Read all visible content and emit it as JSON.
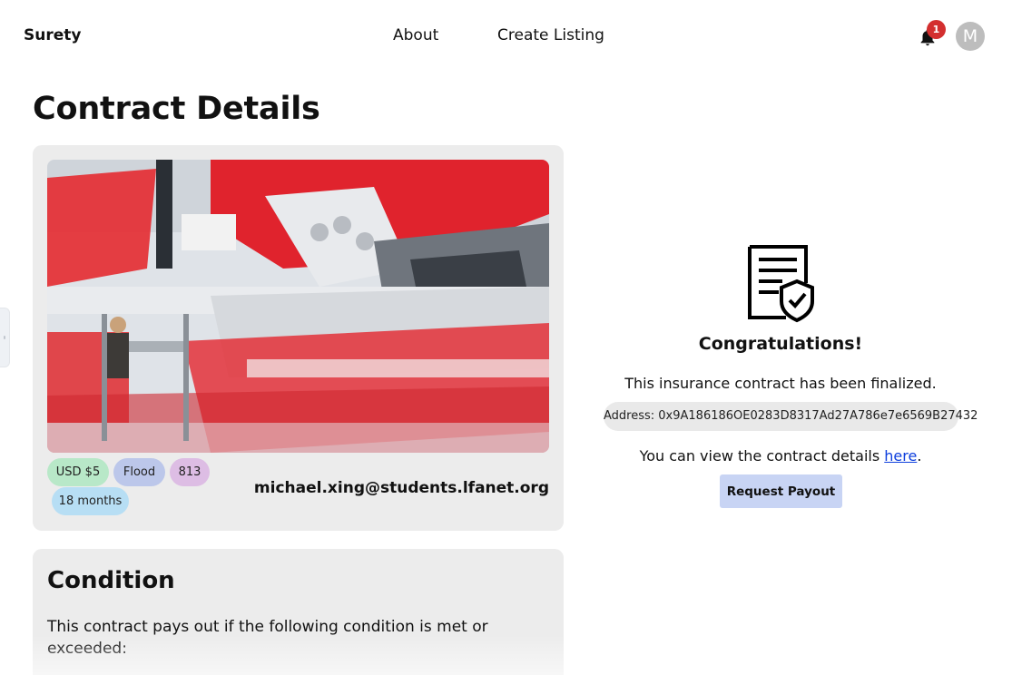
{
  "nav": {
    "brand": "Surety",
    "links": [
      {
        "label": "About"
      },
      {
        "label": "Create Listing"
      }
    ],
    "notification_count": "1",
    "avatar_initial": "M",
    "icons": {
      "notifications": "bell-icon"
    }
  },
  "page": {
    "title": "Contract Details"
  },
  "contract": {
    "tags": {
      "price": "USD $5",
      "peril": "Flood",
      "zip": "813",
      "term": "18 months"
    },
    "owner_email": "michael.xing@students.lfanet.org",
    "image": "factory-assembly-line-photo"
  },
  "condition": {
    "title": "Condition",
    "description": "This contract pays out if the following condition is met or exceeded:"
  },
  "finalized_panel": {
    "icon": "contract-verified-icon",
    "heading": "Congratulations!",
    "message": "This insurance contract has been finalized.",
    "address": "Address: 0x9A186186OE0283D8317Ad27A786e7e6569B27432",
    "view_prefix": "You can view the contract details ",
    "view_link": "here",
    "view_suffix": ".",
    "payout_button": "Request Payout"
  },
  "colors": {
    "tag_price": "#b8e8c8",
    "tag_peril": "#bcc7ea",
    "tag_zip": "#ddbde4",
    "tag_term": "#b7def4",
    "badge": "#d32f2f",
    "payout_button": "#c8d4f4",
    "link": "#0b3ddd"
  }
}
